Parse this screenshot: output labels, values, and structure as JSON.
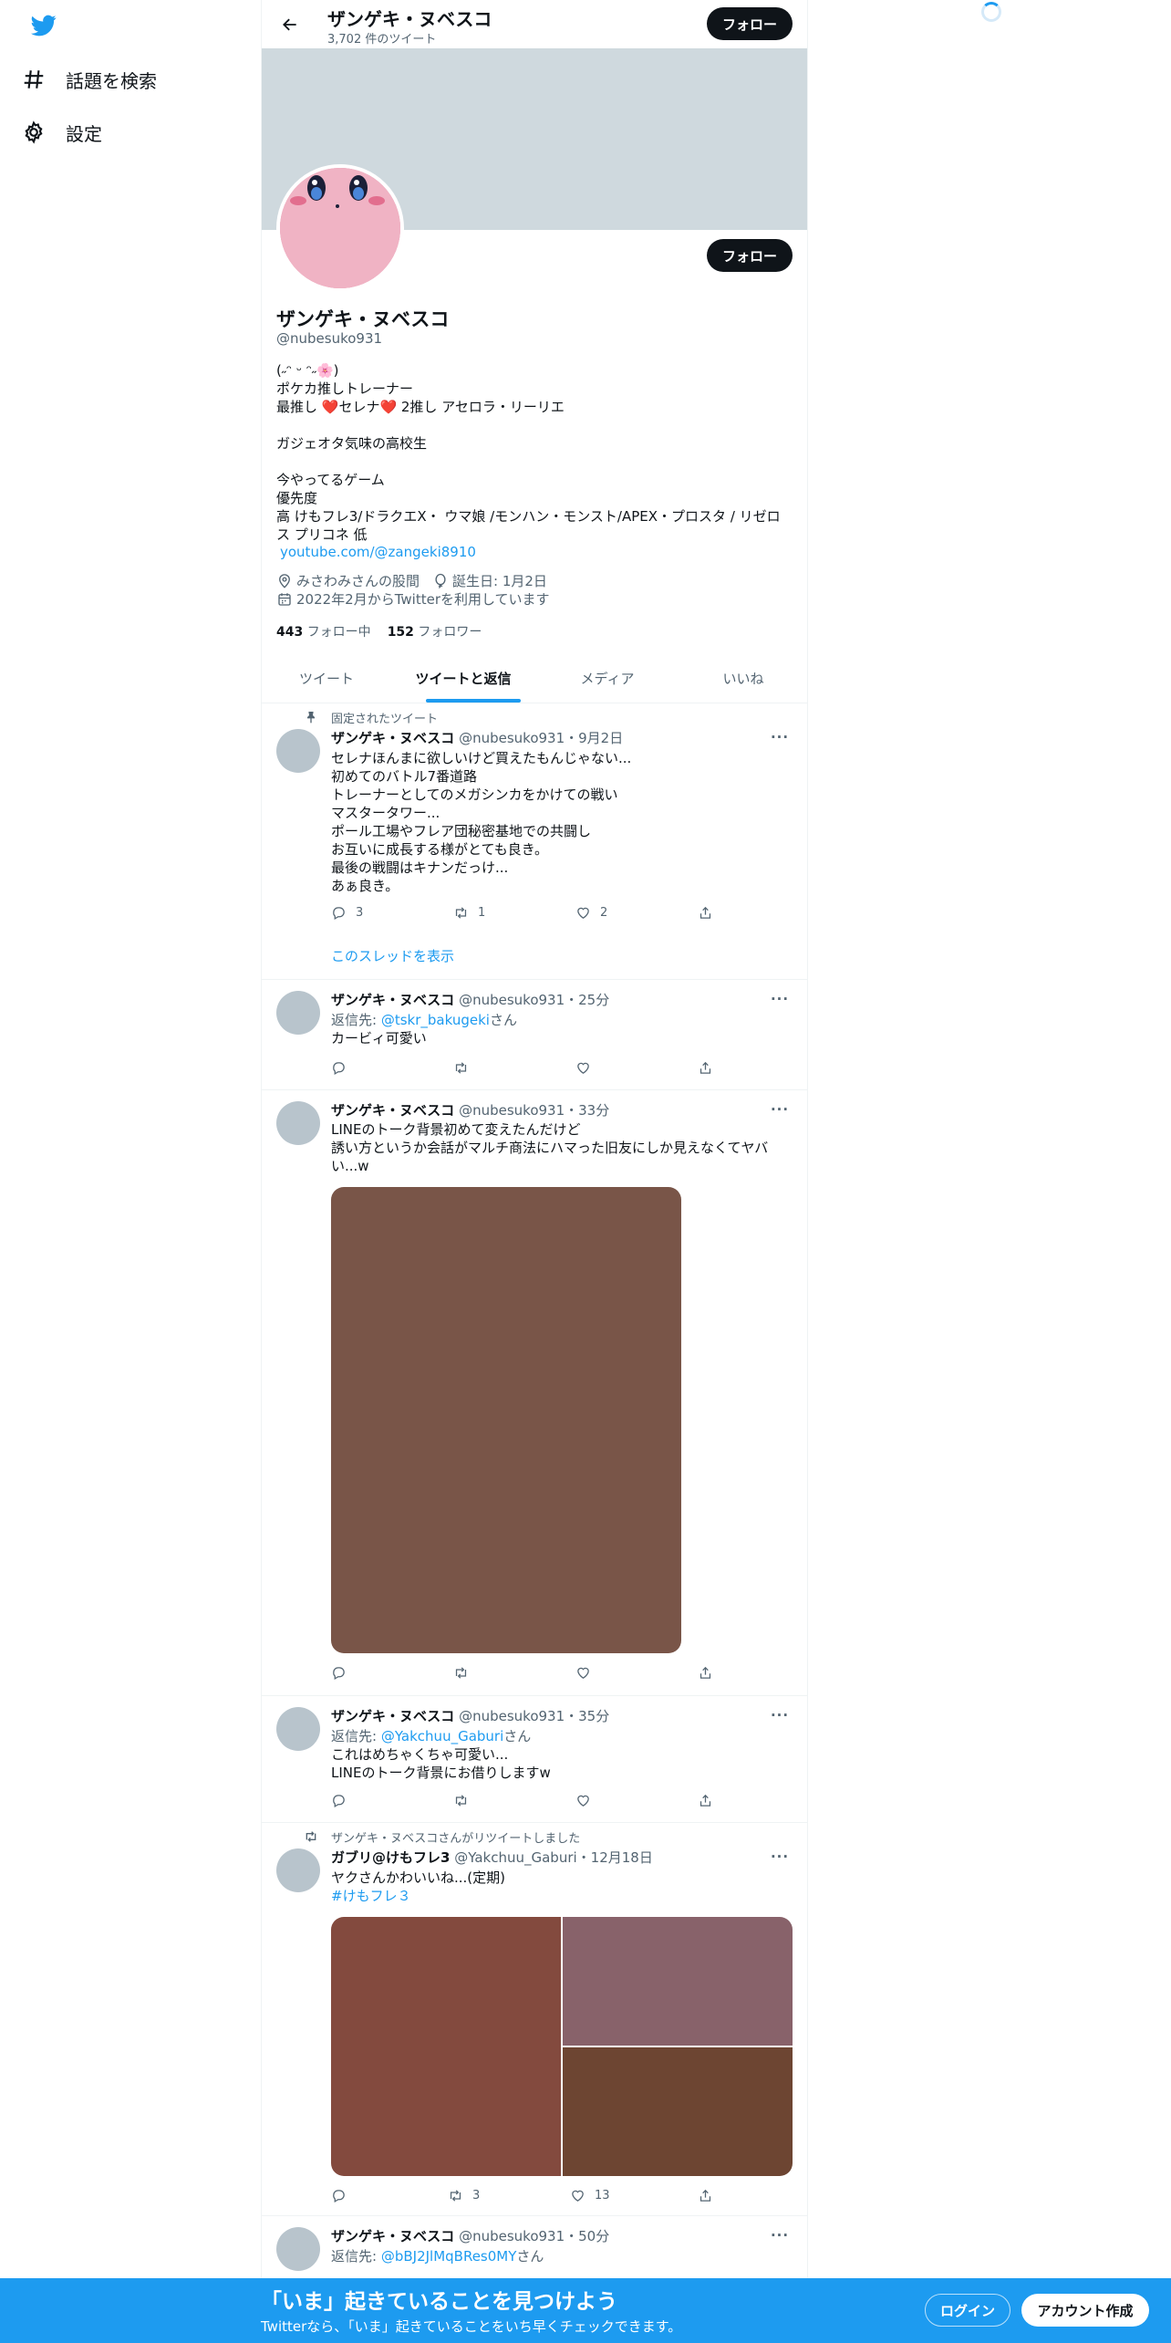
{
  "nav": {
    "explore_label": "話題を検索",
    "settings_label": "設定"
  },
  "header": {
    "name": "ザンゲキ・ヌベスコ",
    "tweet_count": "3,702 件のツイート",
    "follow_label": "フォロー"
  },
  "profile": {
    "name": "ザンゲキ・ヌベスコ",
    "handle": "@nubesuko931",
    "bio": "(˶ᵔ ᵕ ᵔ˶🌸)\nポケカ推しトレーナー\n最推し ❤️セレナ❤️ 2推し アセロラ・リーリエ\n\nガジェオタ気味の高校生\n\n今やってるゲーム\n優先度\n高 けもフレ3/ドラクエX・ ウマ娘 /モンハン・モンスト/APEX・プロスタ / リゼロス プリコネ 低",
    "link": "youtube.com/@zangeki8910",
    "location": "みさわみさんの股間",
    "birthday": "誕生日: 1月2日",
    "joined": "2022年2月からTwitterを利用しています",
    "following_count": "443",
    "following_label": "フォロー中",
    "followers_count": "152",
    "followers_label": "フォロワー",
    "follow_label": "フォロー"
  },
  "tabs": [
    "ツイート",
    "ツイートと返信",
    "メディア",
    "いいね"
  ],
  "active_tab_index": 1,
  "tweets": [
    {
      "social": "固定されたツイート",
      "name": "ザンゲキ・ヌベスコ",
      "handle_time": "@nubesuko931・9月2日",
      "text": "セレナほんまに欲しいけど買えたもんじゃない...\n初めてのバトル7番道路\nトレーナーとしてのメガシンカをかけての戦い\nマスタータワー...\nポール工場やフレア団秘密基地での共闘し\nお互いに成長する様がとても良き。\n最後の戦闘はキナンだっけ...\nあぁ良き。",
      "replies": "3",
      "retweets": "1",
      "likes": "2",
      "show_thread": "このスレッドを表示"
    },
    {
      "name": "ザンゲキ・ヌベスコ",
      "handle_time": "@nubesuko931・25分",
      "reply_prefix": "返信先: ",
      "reply_handle": "@tskr_bakugeki",
      "reply_suffix": "さん",
      "text": "カービィ可愛い"
    },
    {
      "name": "ザンゲキ・ヌベスコ",
      "handle_time": "@nubesuko931・33分",
      "text": "LINEのトーク背景初めて変えたんだけど\n誘い方というか会話がマルチ商法にハマった旧友にしか見えなくてヤバい...w",
      "media_color": "#795548"
    },
    {
      "name": "ザンゲキ・ヌベスコ",
      "handle_time": "@nubesuko931・35分",
      "reply_prefix": "返信先: ",
      "reply_handle": "@Yakchuu_Gaburi",
      "reply_suffix": "さん",
      "text": "これはめちゃくちゃ可愛い...\nLINEのトーク背景にお借りしますw"
    },
    {
      "social": "ザンゲキ・ヌベスコさんがリツイートしました",
      "name": "ガブリ@けもフレ3",
      "handle_time": "@Yakchuu_Gaburi・12月18日",
      "text": "ヤクさんかわいいね...(定期)",
      "hashtag": "#けもフレ３",
      "retweets": "3",
      "likes": "13",
      "media_colors": [
        "#834a3e",
        "#88626a",
        "#6d4532"
      ]
    },
    {
      "name": "ザンゲキ・ヌベスコ",
      "handle_time": "@nubesuko931・50分",
      "reply_prefix": "返信先: ",
      "reply_handle": "@bBJ2JlMqBRes0MY",
      "reply_suffix": "さん"
    }
  ],
  "bottom_bar": {
    "title": "「いま」起きていることを見つけよう",
    "subtitle": "Twitterなら、「いま」起きていることをいち早くチェックできます。",
    "login_label": "ログイン",
    "signup_label": "アカウント作成"
  },
  "colors": {
    "accent": "#1d9bf0",
    "banner": "#cfd9de",
    "dark": "#0f1419"
  }
}
